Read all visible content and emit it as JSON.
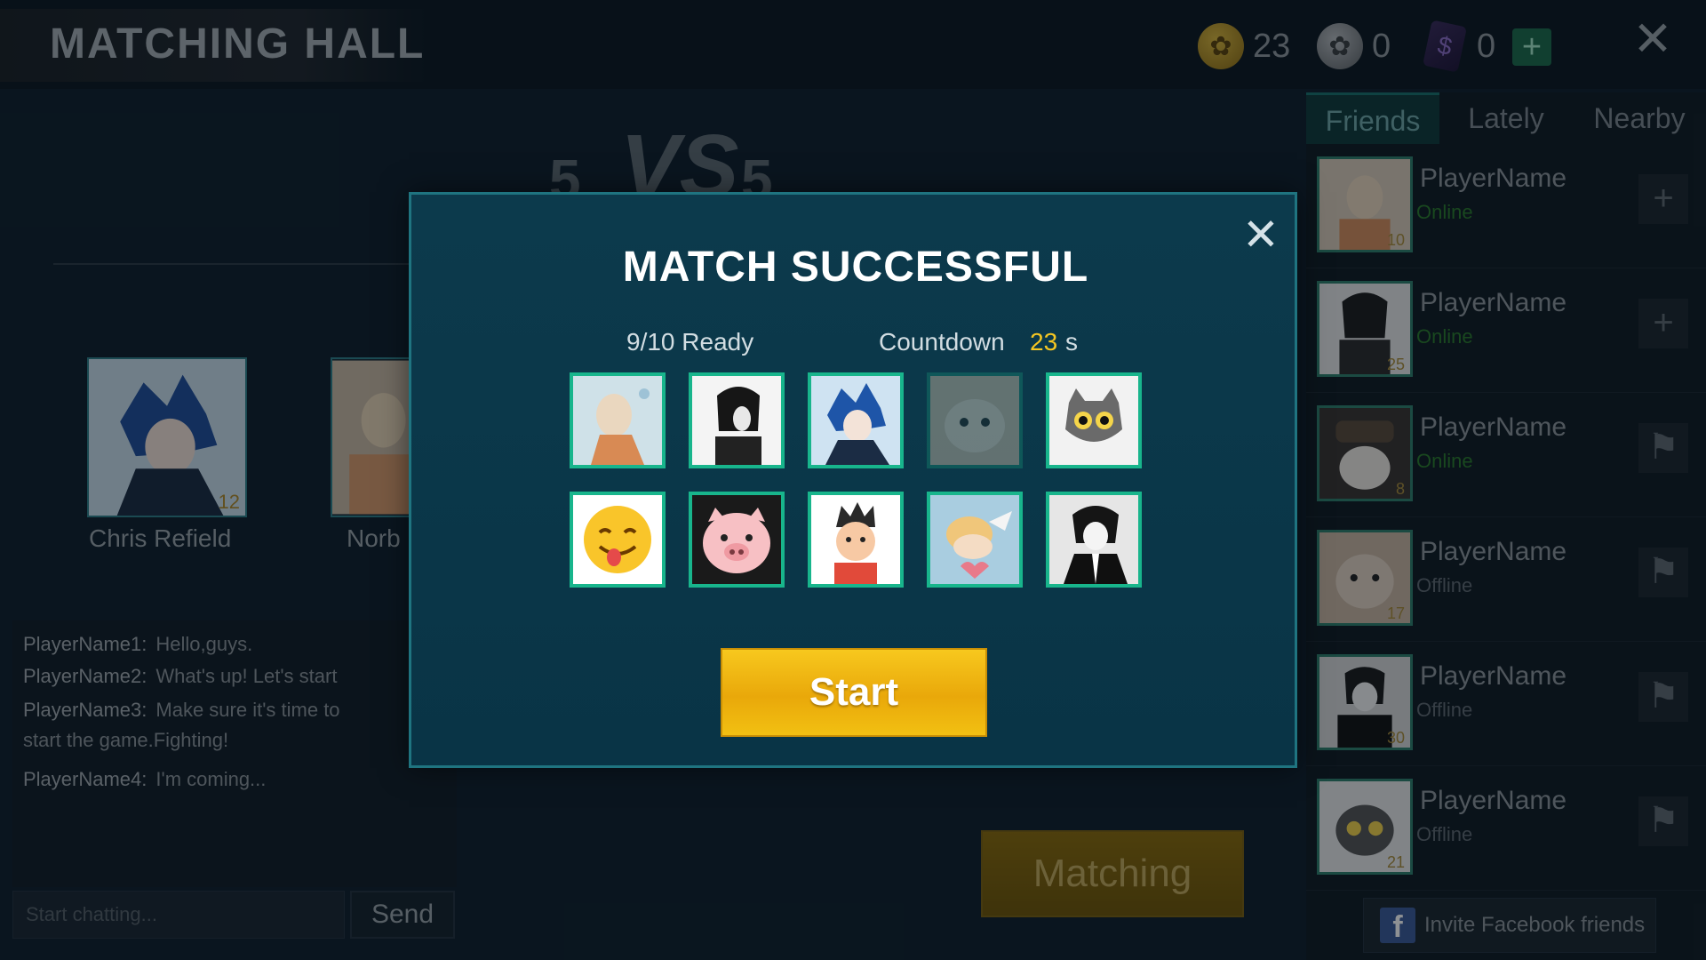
{
  "header": {
    "title": "MATCHING HALL",
    "gold": "23",
    "silver": "0",
    "cards": "0",
    "plus": "+",
    "close": "✕"
  },
  "versus": {
    "left": "5",
    "right": "5",
    "logo": "VS"
  },
  "players": [
    {
      "name": "Chris Refield",
      "level": "12"
    },
    {
      "name": "Norb",
      "level": ""
    }
  ],
  "chat": {
    "lines": [
      {
        "who": "PlayerName1:",
        "text": "Hello,guys."
      },
      {
        "who": "PlayerName2:",
        "text": "What's up! Let's start"
      },
      {
        "who": "PlayerName3:",
        "text": "Make sure it's time to"
      },
      {
        "who": "",
        "text": "start the game.Fighting!"
      },
      {
        "who": "PlayerName4:",
        "text": "I'm coming..."
      }
    ],
    "placeholder": "Start chatting...",
    "send": "Send"
  },
  "matching_button": "Matching",
  "tabs": [
    "Friends",
    "Lately",
    "Nearby"
  ],
  "friends": [
    {
      "name": "PlayerName",
      "status": "Online",
      "level": "10",
      "action": "+"
    },
    {
      "name": "PlayerName",
      "status": "Online",
      "level": "25",
      "action": "+"
    },
    {
      "name": "PlayerName",
      "status": "Online",
      "level": "8",
      "action": "⚑"
    },
    {
      "name": "PlayerName",
      "status": "Offline",
      "level": "17",
      "action": "⚑"
    },
    {
      "name": "PlayerName",
      "status": "Offline",
      "level": "30",
      "action": "⚑"
    },
    {
      "name": "PlayerName",
      "status": "Offline",
      "level": "21",
      "action": "⚑"
    }
  ],
  "invite": {
    "icon": "f",
    "label": "Invite Facebook friends"
  },
  "modal": {
    "title": "MATCH SUCCESSFUL",
    "ready": "9/10 Ready",
    "countdown_label": "Countdown",
    "countdown_value": "23",
    "countdown_unit": "s",
    "start": "Start",
    "close": "✕"
  },
  "colors": {
    "accent": "#18b58c",
    "countdown": "#f5c622",
    "start_button": "#f2b915",
    "online": "#2a7a2a"
  }
}
